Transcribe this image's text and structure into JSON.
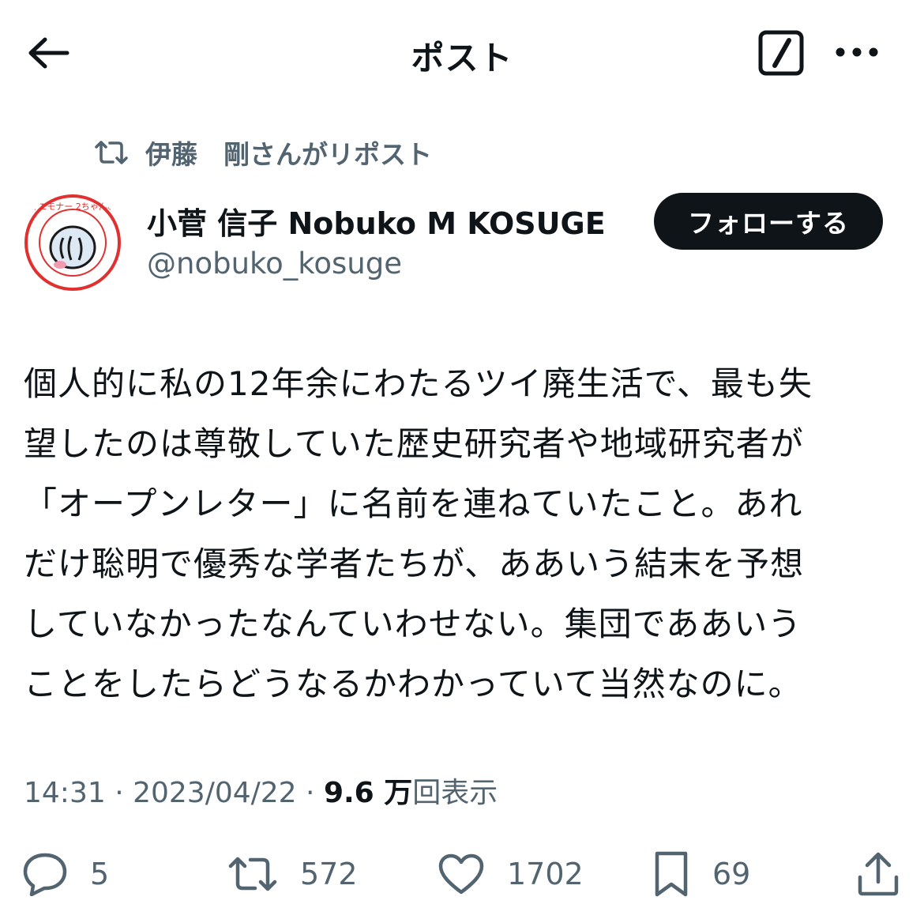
{
  "header": {
    "title": "ポスト"
  },
  "repost_context": {
    "text": "伊藤　剛さんがリポスト"
  },
  "author": {
    "name": "小菅 信子 Nobuko M KOSUGE",
    "handle": "@nobuko_kosuge",
    "avatar_text": "オマエモナー 2ちゃんねる"
  },
  "follow_button": {
    "label": "フォローする"
  },
  "tweet": {
    "text": "個人的に私の12年余にわたるツイ廃生活で、最も失\n望したのは尊敬していた歴史研究者や地域研究者が\n「オープンレター」に名前を連ねていたこと。あれ\nだけ聡明で優秀な学者たちが、ああいう結末を予想\nしていなかったなんていわせない。集団でああいう\nことをしたらどうなるかわかっていて当然なのに。"
  },
  "meta": {
    "time": "14:31",
    "date": "2023/04/22",
    "views_num": "9.6 万",
    "views_label": "回表示"
  },
  "actions": {
    "replies": "5",
    "reposts": "572",
    "likes": "1702",
    "bookmarks": "69"
  },
  "colors": {
    "text": "#0f1419",
    "secondary": "#536471",
    "button_bg": "#0f1419"
  },
  "icons": {
    "back": "arrow-left-icon",
    "grok": "slash-box-icon",
    "more": "ellipsis-icon",
    "repost": "repost-icon",
    "reply": "reply-icon",
    "like": "heart-icon",
    "bookmark": "bookmark-icon",
    "share": "share-icon"
  }
}
